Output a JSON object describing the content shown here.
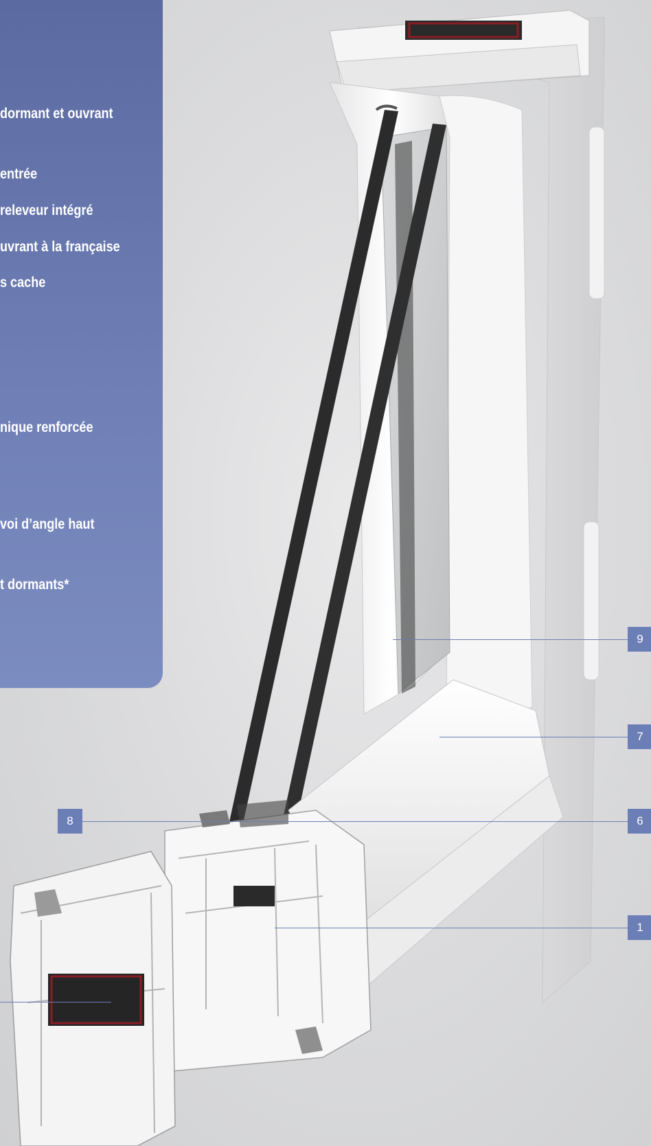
{
  "features": [
    "dormant et ouvrant",
    "entrée",
    "releveur intégré",
    "uvrant à la française",
    "s cache",
    "nique renforcée",
    "voi d’angle haut",
    "t dormants*"
  ],
  "callouts": [
    "9",
    "7",
    "8",
    "6",
    "1"
  ],
  "colors": {
    "panel": "#6f7fb6",
    "tag": "#6b7eb6",
    "pvc_white": "#f4f4f4",
    "gasket": "#2b2b2b",
    "spacer": "#8a1d24"
  }
}
